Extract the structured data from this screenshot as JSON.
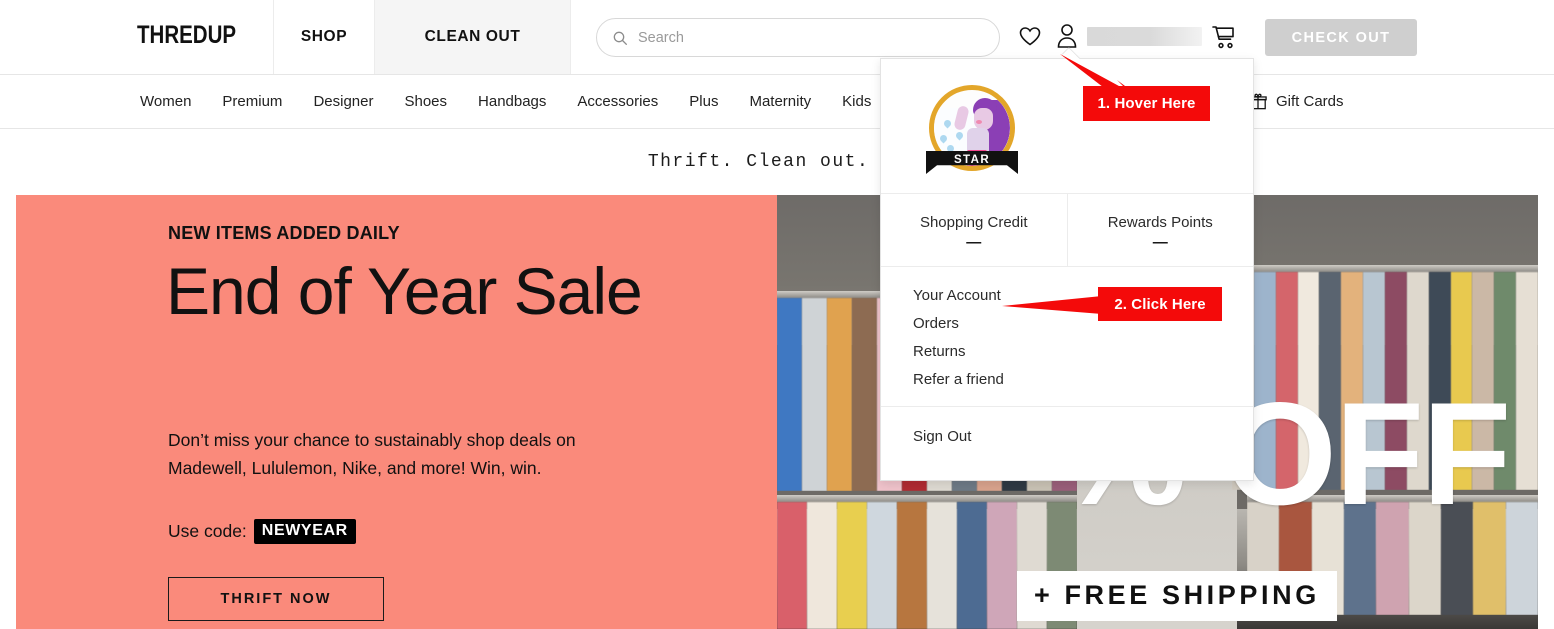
{
  "header": {
    "brand": "THREDUP",
    "brand_part1": "THRED",
    "brand_part2": "UP",
    "tabs": [
      {
        "label": "SHOP"
      },
      {
        "label": "CLEAN OUT"
      }
    ],
    "search": {
      "placeholder": "Search",
      "value": "",
      "icon": "search-icon"
    },
    "icons": [
      {
        "name": "heart-icon"
      },
      {
        "name": "person-icon"
      },
      {
        "name": "cart-icon"
      }
    ],
    "username_redacted": "",
    "checkout_label": "CHECK OUT"
  },
  "category_nav": {
    "items": [
      {
        "label": "Women"
      },
      {
        "label": "Premium"
      },
      {
        "label": "Designer"
      },
      {
        "label": "Shoes"
      },
      {
        "label": "Handbags"
      },
      {
        "label": "Accessories"
      },
      {
        "label": "Plus"
      },
      {
        "label": "Maternity"
      },
      {
        "label": "Kids"
      }
    ],
    "gift_cards": {
      "label": "Gift Cards",
      "icon": "gift-icon"
    }
  },
  "tagline": "Thrift. Clean out. Do",
  "hero": {
    "eyebrow": "NEW ITEMS ADDED DAILY",
    "title": "End of Year Sale",
    "body": "Don’t miss your chance to sustainably shop deals on Madewell, Lululemon, Nike, and more! Win, win.",
    "code_prefix": "Use code:",
    "code": "NEWYEAR",
    "cta_label": "THRIFT NOW",
    "background_color": "#fa8a7b",
    "photo_overlay": {
      "headline": "% OFF",
      "subline": "+ FREE SHIPPING"
    }
  },
  "account_dropdown": {
    "avatar": {
      "badge_label": "STAR",
      "ring_color": "#e3a62a"
    },
    "display_name_redacted": "",
    "stats": [
      {
        "label": "Shopping Credit",
        "value": "—"
      },
      {
        "label": "Rewards Points",
        "value": "—"
      }
    ],
    "menu": [
      {
        "label": "Your Account"
      },
      {
        "label": "Orders"
      },
      {
        "label": "Returns"
      },
      {
        "label": "Refer a friend"
      }
    ],
    "sign_out": "Sign Out"
  },
  "annotations": {
    "color": "#f40a0a",
    "step1": "1. Hover Here",
    "step2": "2. Click Here"
  }
}
